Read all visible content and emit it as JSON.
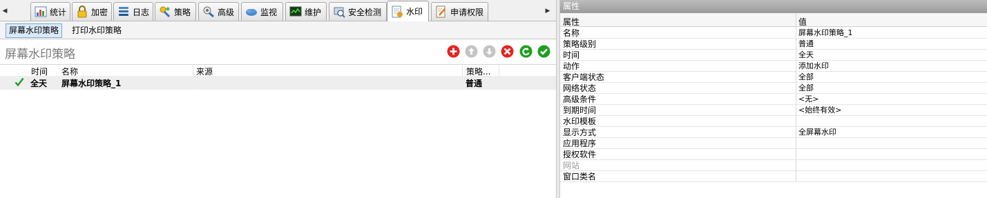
{
  "tabs": [
    {
      "label": "统计",
      "icon": "bar-chart-icon",
      "active": false
    },
    {
      "label": "加密",
      "icon": "padlock-icon",
      "active": false
    },
    {
      "label": "日志",
      "icon": "log-stack-icon",
      "active": false
    },
    {
      "label": "策略",
      "icon": "policy-icon",
      "active": false
    },
    {
      "label": "高级",
      "icon": "advanced-icon",
      "active": false
    },
    {
      "label": "监视",
      "icon": "monitor-cloud-icon",
      "active": false
    },
    {
      "label": "维护",
      "icon": "maintenance-screen-icon",
      "active": false
    },
    {
      "label": "安全检测",
      "icon": "security-scan-icon",
      "active": false
    },
    {
      "label": "水印",
      "icon": "watermark-document-icon",
      "active": true
    },
    {
      "label": "申请权限",
      "icon": "apply-permission-icon",
      "active": false
    }
  ],
  "subtabs": [
    {
      "label": "屏幕水印策略",
      "active": true
    },
    {
      "label": "打印水印策略",
      "active": false
    }
  ],
  "page_title": "屏幕水印策略",
  "actions": [
    {
      "name": "add",
      "icon": "add-icon",
      "color": "#e52323",
      "enabled": true
    },
    {
      "name": "move-up",
      "icon": "arrow-up-icon",
      "color": "#c4c4c4",
      "enabled": false
    },
    {
      "name": "move-down",
      "icon": "arrow-down-icon",
      "color": "#c4c4c4",
      "enabled": false
    },
    {
      "name": "delete",
      "icon": "delete-icon",
      "color": "#e52323",
      "enabled": true
    },
    {
      "name": "undo",
      "icon": "undo-icon",
      "color": "#1ea01e",
      "enabled": true
    },
    {
      "name": "apply",
      "icon": "apply-check-icon",
      "color": "#1ea01e",
      "enabled": true
    }
  ],
  "grid": {
    "columns": [
      "时间",
      "名称",
      "来源",
      "策略..."
    ],
    "rows": [
      {
        "checked": true,
        "time": "全天",
        "name": "屏幕水印策略_1",
        "source": "",
        "level": "普通"
      }
    ]
  },
  "properties_panel": {
    "title": "属性",
    "col_name": "属性",
    "col_value": "值",
    "rows": [
      {
        "name": "名称",
        "value": "屏幕水印策略_1",
        "disabled": false
      },
      {
        "name": "策略级别",
        "value": "普通",
        "disabled": false
      },
      {
        "name": "时间",
        "value": "全天",
        "disabled": false
      },
      {
        "name": "动作",
        "value": "添加水印",
        "disabled": false
      },
      {
        "name": "客户端状态",
        "value": "全部",
        "disabled": false
      },
      {
        "name": "网络状态",
        "value": "全部",
        "disabled": false
      },
      {
        "name": "高级条件",
        "value": "<无>",
        "disabled": false
      },
      {
        "name": "到期时间",
        "value": "<始终有效>",
        "disabled": false
      },
      {
        "name": "水印模板",
        "value": "",
        "disabled": false
      },
      {
        "name": "显示方式",
        "value": "全屏幕水印",
        "disabled": false
      },
      {
        "name": "应用程序",
        "value": "",
        "disabled": false
      },
      {
        "name": "授权软件",
        "value": "",
        "disabled": false
      },
      {
        "name": "网站",
        "value": "",
        "disabled": true
      },
      {
        "name": "窗口类名",
        "value": "",
        "disabled": false
      }
    ]
  },
  "colors": {
    "accent_check": "#1e9a1e",
    "selected_subtab_bg": "#dbeaf9"
  }
}
